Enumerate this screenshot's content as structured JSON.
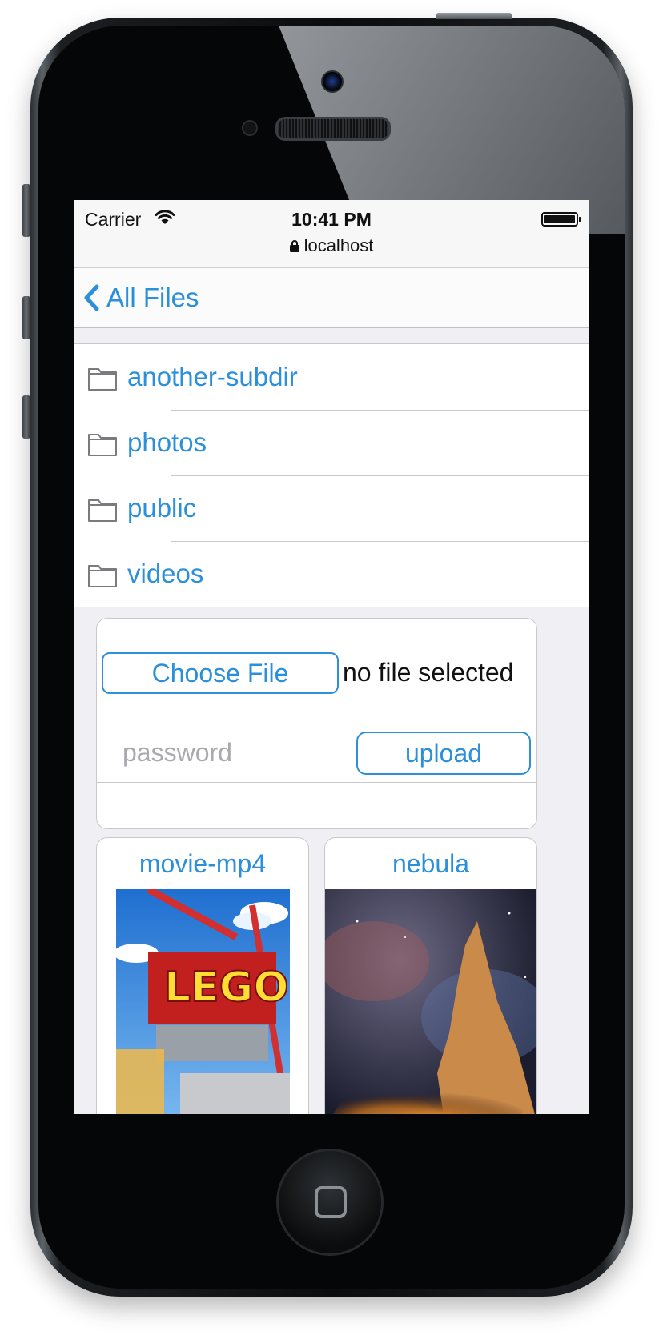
{
  "status_bar": {
    "carrier": "Carrier",
    "time": "10:41 PM",
    "url": "localhost"
  },
  "nav": {
    "back_label": "All Files"
  },
  "folders": [
    {
      "name": "another-subdir",
      "icon": "folder-icon"
    },
    {
      "name": "photos",
      "icon": "folder-icon"
    },
    {
      "name": "public",
      "icon": "folder-icon"
    },
    {
      "name": "videos",
      "icon": "folder-icon"
    }
  ],
  "upload": {
    "choose_label": "Choose File",
    "no_file_text": "no file selected",
    "password_placeholder": "password",
    "upload_label": "upload"
  },
  "tiles": [
    {
      "title": "movie-mp4"
    },
    {
      "title": "nebula"
    }
  ],
  "colors": {
    "accent": "#2b8fd9",
    "separator": "#c8c7cc",
    "background": "#efeff4"
  }
}
